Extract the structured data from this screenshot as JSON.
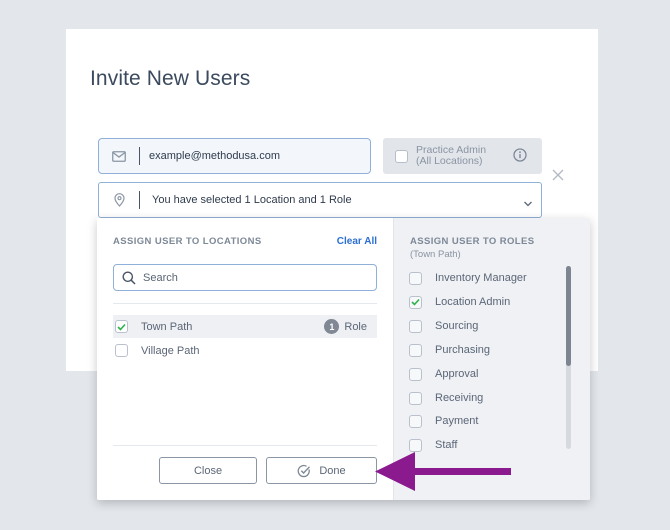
{
  "modal": {
    "title": "Invite New Users",
    "email": {
      "value": "example@methodusa.com",
      "icon": "mail-icon"
    },
    "practice_admin": {
      "line1": "Practice Admin",
      "line2": "(All Locations)",
      "checked": false,
      "icon": "info-icon"
    },
    "close_icon": "close-icon",
    "location_select": {
      "text": "You have selected 1 Location and 1 Role",
      "icon": "location-pin-icon"
    }
  },
  "locations_panel": {
    "title": "ASSIGN USER TO LOCATIONS",
    "clear_all": "Clear All",
    "search_placeholder": "Search",
    "items": [
      {
        "label": "Town Path",
        "checked": true,
        "badge_count": "1",
        "badge_label": "Role"
      },
      {
        "label": "Village Path",
        "checked": false
      }
    ],
    "close_button": "Close",
    "done_button": "Done"
  },
  "roles_panel": {
    "title": "ASSIGN USER TO ROLES",
    "subtitle": "(Town Path)",
    "roles": [
      {
        "label": "Inventory Manager",
        "checked": false
      },
      {
        "label": "Location Admin",
        "checked": true
      },
      {
        "label": "Sourcing",
        "checked": false
      },
      {
        "label": "Purchasing",
        "checked": false
      },
      {
        "label": "Approval",
        "checked": false
      },
      {
        "label": "Receiving",
        "checked": false
      },
      {
        "label": "Payment",
        "checked": false
      },
      {
        "label": "Staff",
        "checked": false
      }
    ]
  },
  "colors": {
    "accent": "#2c6fd1",
    "check": "#2fb24c",
    "annotation_arrow": "#8b1a8f",
    "border_focus": "#8fb0d8"
  }
}
